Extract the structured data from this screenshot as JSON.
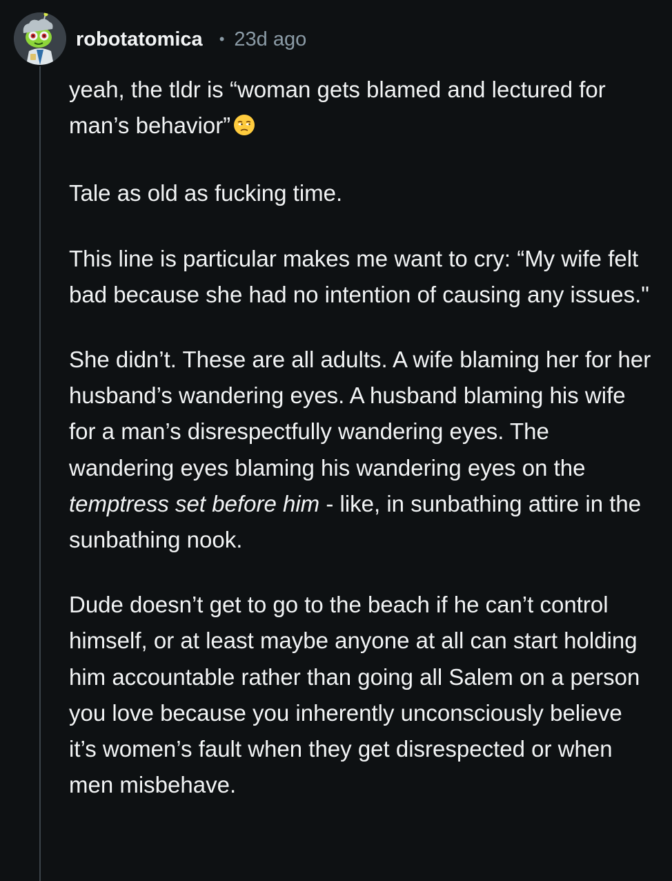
{
  "comment": {
    "username": "robotatomica",
    "separator": "•",
    "timestamp": "23d ago",
    "avatar_icon": "snoo-avatar-icon",
    "paragraphs": {
      "p1": "yeah, the tldr is “woman gets blamed and lectured for man’s behavior”",
      "p1_emoji": "unamused-face-emoji",
      "p2": "Tale as old as fucking time.",
      "p3": "This line is particular makes me want to cry: “My wife felt bad because she had no intention of causing any issues.\"",
      "p4_before": "She didn’t. These are all adults. A wife blaming her for her husband’s wandering eyes. A husband blaming his wife for a man’s disrespectfully wandering eyes. The wandering eyes blaming his wandering eyes on the ",
      "p4_italic": "temptress set before him",
      "p4_after": " - like, in sunbathing attire in the sunbathing nook.",
      "p5": "Dude doesn’t get to go to the beach if he can’t control himself, or at least maybe anyone at all can start holding him accountable rather than going all Salem on a person you love because you inherently unconsciously believe it’s women’s fault when they get disrespected or when men misbehave."
    }
  },
  "colors": {
    "background": "#0e1113",
    "text": "#f2f4f5",
    "muted": "#8b9ba6",
    "thread_line": "#3b4349"
  }
}
